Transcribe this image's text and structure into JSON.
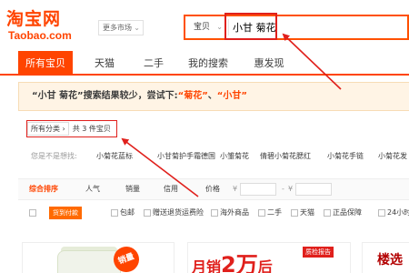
{
  "logo": {
    "cn": "淘宝网",
    "en": "Taobao.com"
  },
  "market": {
    "label": "更多市场"
  },
  "search": {
    "type": "宝贝",
    "query": "小甘 菊花"
  },
  "nav": {
    "tabs": [
      "所有宝贝",
      "天猫",
      "二手",
      "我的搜索",
      "惠发现"
    ]
  },
  "notice": {
    "prefix": "“小甘 菊花”搜索结果较少，尝试下:",
    "kw1": "“菊花”",
    "sep": "、",
    "kw2": "“小甘”"
  },
  "breadcrumb": {
    "all": "所有分类",
    "arrow": "›",
    "count": "共 3 件宝贝"
  },
  "suggestions": {
    "label": "您是不是想找:",
    "items": [
      "小菊花蓝标",
      "小甘菊护手霜德国",
      "小雏菊花",
      "倩碧小菊花腮红",
      "小菊花手链",
      "小菊花发"
    ]
  },
  "sort": {
    "items": [
      "综合排序",
      "人气",
      "销量",
      "信用",
      "价格"
    ],
    "price_sep": "-",
    "price_arrow": "¥"
  },
  "filters": {
    "items": [
      "货到付款",
      "包邮",
      "赠送退货运费险",
      "海外商品",
      "二手",
      "天猫",
      "正品保障",
      "24小时内发"
    ]
  },
  "products": {
    "p1_badge": "销量",
    "p2_prefix": "月销",
    "p2_big": "2万",
    "p2_suffix": "后",
    "p2_tag": "质检报告",
    "p3_text": "楼选"
  },
  "colors": {
    "brand": "#ff4400",
    "annotation": "#e0201c"
  }
}
